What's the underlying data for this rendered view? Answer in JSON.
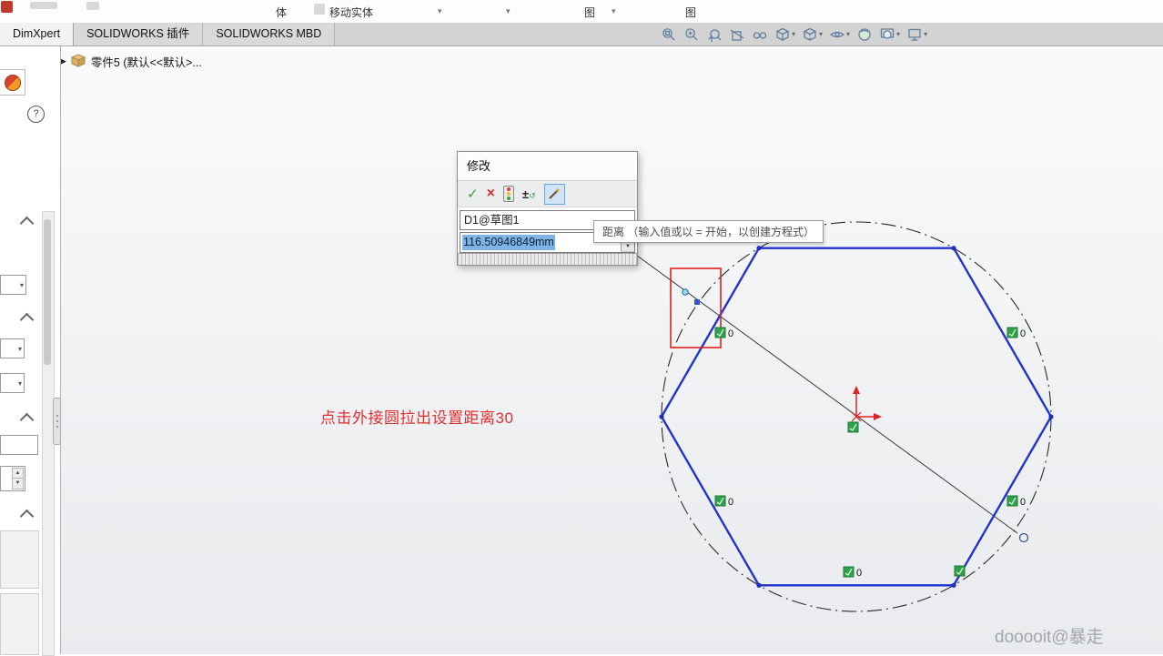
{
  "ribbon": {
    "partial_labels": [
      "体",
      "移动实体",
      "图",
      "图"
    ]
  },
  "tabs": [
    {
      "label": "DimXpert"
    },
    {
      "label": "SOLIDWORKS 插件"
    },
    {
      "label": "SOLIDWORKS MBD"
    }
  ],
  "feature_tree": {
    "root_label": "零件5 (默认<<默认>..."
  },
  "help_icon": "?",
  "modify_dialog": {
    "title": "修改",
    "dimension_name": "D1@草图1",
    "value": "116.50946849mm"
  },
  "tooltip": {
    "text": "距离 （输入值或以 = 开始，以创建方程式）"
  },
  "sketch": {
    "annotation": "点击外接圆拉出设置距离30",
    "relation_badge_label": "0"
  },
  "watermark": "dooooit@暴走",
  "glyphs": {
    "dropdown_caret": "▾",
    "spin_up": "▲",
    "spin_down": "▼",
    "accept": "✓",
    "cancel": "×",
    "plus_minus": "±",
    "reverse_arrow": "↺",
    "tree_expand": "▶"
  },
  "colors": {
    "sketch_blue": "#2133cc",
    "construction_black": "#2a2a2a",
    "relation_green": "#2fa14b",
    "alert_red": "#e02020",
    "selection_blue": "#7fb4e4",
    "icon_steel": "#5f7fa0"
  }
}
